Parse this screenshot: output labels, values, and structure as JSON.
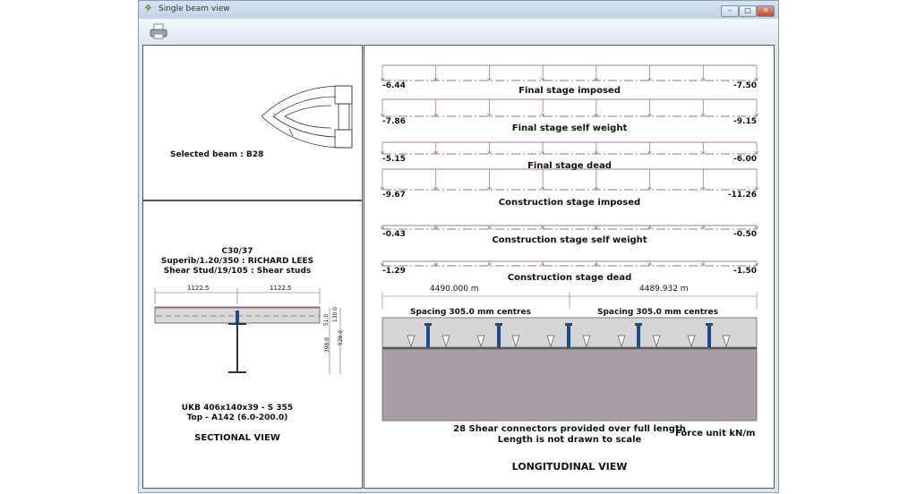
{
  "window": {
    "title": "Single beam view"
  },
  "toolbar": {
    "print_icon": "printer-icon"
  },
  "plan": {
    "selected_beam": "Selected beam : B28"
  },
  "section": {
    "concrete": "C30/37",
    "deck": "Superib/1.20/350 : RICHARD LEES",
    "stud": "Shear Stud/19/105 : Shear studs",
    "dim_left": "1122.5",
    "dim_right": "1122.5",
    "dim_51": "51.0",
    "dim_130": "130.0",
    "dim_398": "398.0",
    "dim_528": "528.0",
    "beam": "UKB 406x140x39 - S 355",
    "mesh": "Top - A142 (6.0-200.0)",
    "title": "SECTIONAL VIEW"
  },
  "loads": [
    {
      "name": "Final stage imposed",
      "left": "-6.44",
      "right": "-7.50"
    },
    {
      "name": "Final stage self weight",
      "left": "-7.86",
      "right": "-9.15"
    },
    {
      "name": "Final stage dead",
      "left": "-5.15",
      "right": "-6.00"
    },
    {
      "name": "Construction stage imposed",
      "left": "-9.67",
      "right": "-11.26"
    },
    {
      "name": "Construction stage self weight",
      "left": "-0.43",
      "right": "-0.50"
    },
    {
      "name": "Construction stage dead",
      "left": "-1.29",
      "right": "-1.50"
    }
  ],
  "longitudinal": {
    "span_left": "4490.000 m",
    "span_right": "4489.932 m",
    "spacing_left": "Spacing 305.0 mm centres",
    "spacing_right": "Spacing 305.0 mm centres",
    "connectors": "28 Shear connectors provided over full length",
    "note": "Length is not drawn to scale",
    "force_unit": "Force unit kN/m",
    "title": "LONGITUDINAL VIEW"
  },
  "colors": {
    "stud": "#1f4b8e",
    "slab": "#d6d6d6",
    "beam": "#a8a0a6",
    "load": "#a07aa6"
  }
}
